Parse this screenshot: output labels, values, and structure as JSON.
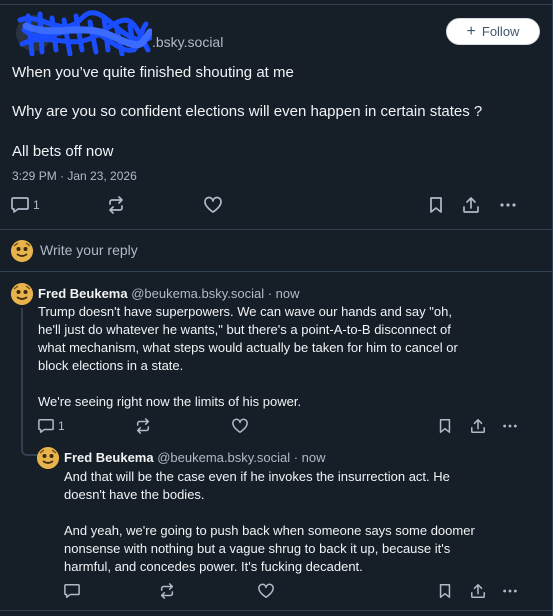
{
  "post": {
    "handle": ".bsky.social",
    "follow_label": "Follow",
    "lines": [
      "When you’ve quite finished shouting at me",
      "Why are you so confident elections will even happen in certain states ?",
      "All bets off now"
    ],
    "timestamp": "3:29 PM · Jan 23, 2026",
    "reply_count": "1"
  },
  "composer": {
    "placeholder": "Write your reply"
  },
  "replies": [
    {
      "name": "Fred Beukema",
      "meta": "@beukema.bsky.social · now",
      "paragraph1": [
        "Trump doesn't have superpowers. We can wave our hands and say \"oh,",
        "he'll just do whatever he wants,\" but there's a point-A-to-B disconnect of",
        "what mechanism, what steps would actually be taken for him to cancel or",
        "block elections in a state."
      ],
      "paragraph2": [
        "We're seeing right now the limits of his power."
      ],
      "reply_count": "1"
    },
    {
      "name": "Fred Beukema",
      "meta": "@beukema.bsky.social · now",
      "paragraph1": [
        "And that will be the case even if he invokes the insurrection act. He",
        "doesn't have the bodies."
      ],
      "paragraph2": [
        "And yeah, we're going to push back when someone says some doomer",
        "nonsense with nothing but a vague shrug to back it up, because it's",
        "harmful, and concedes power. It's fucking decadent."
      ],
      "reply_count": ""
    }
  ],
  "colors": {
    "background": "#161e27",
    "text": "#f1f3f5",
    "muted": "#aebbc9",
    "border": "#2e4052",
    "scribble": "#1a4dff"
  },
  "icons": [
    "reply-icon",
    "repost-icon",
    "like-icon",
    "bookmark-icon",
    "share-icon",
    "more-icon",
    "plus-icon",
    "redaction-scribble"
  ]
}
